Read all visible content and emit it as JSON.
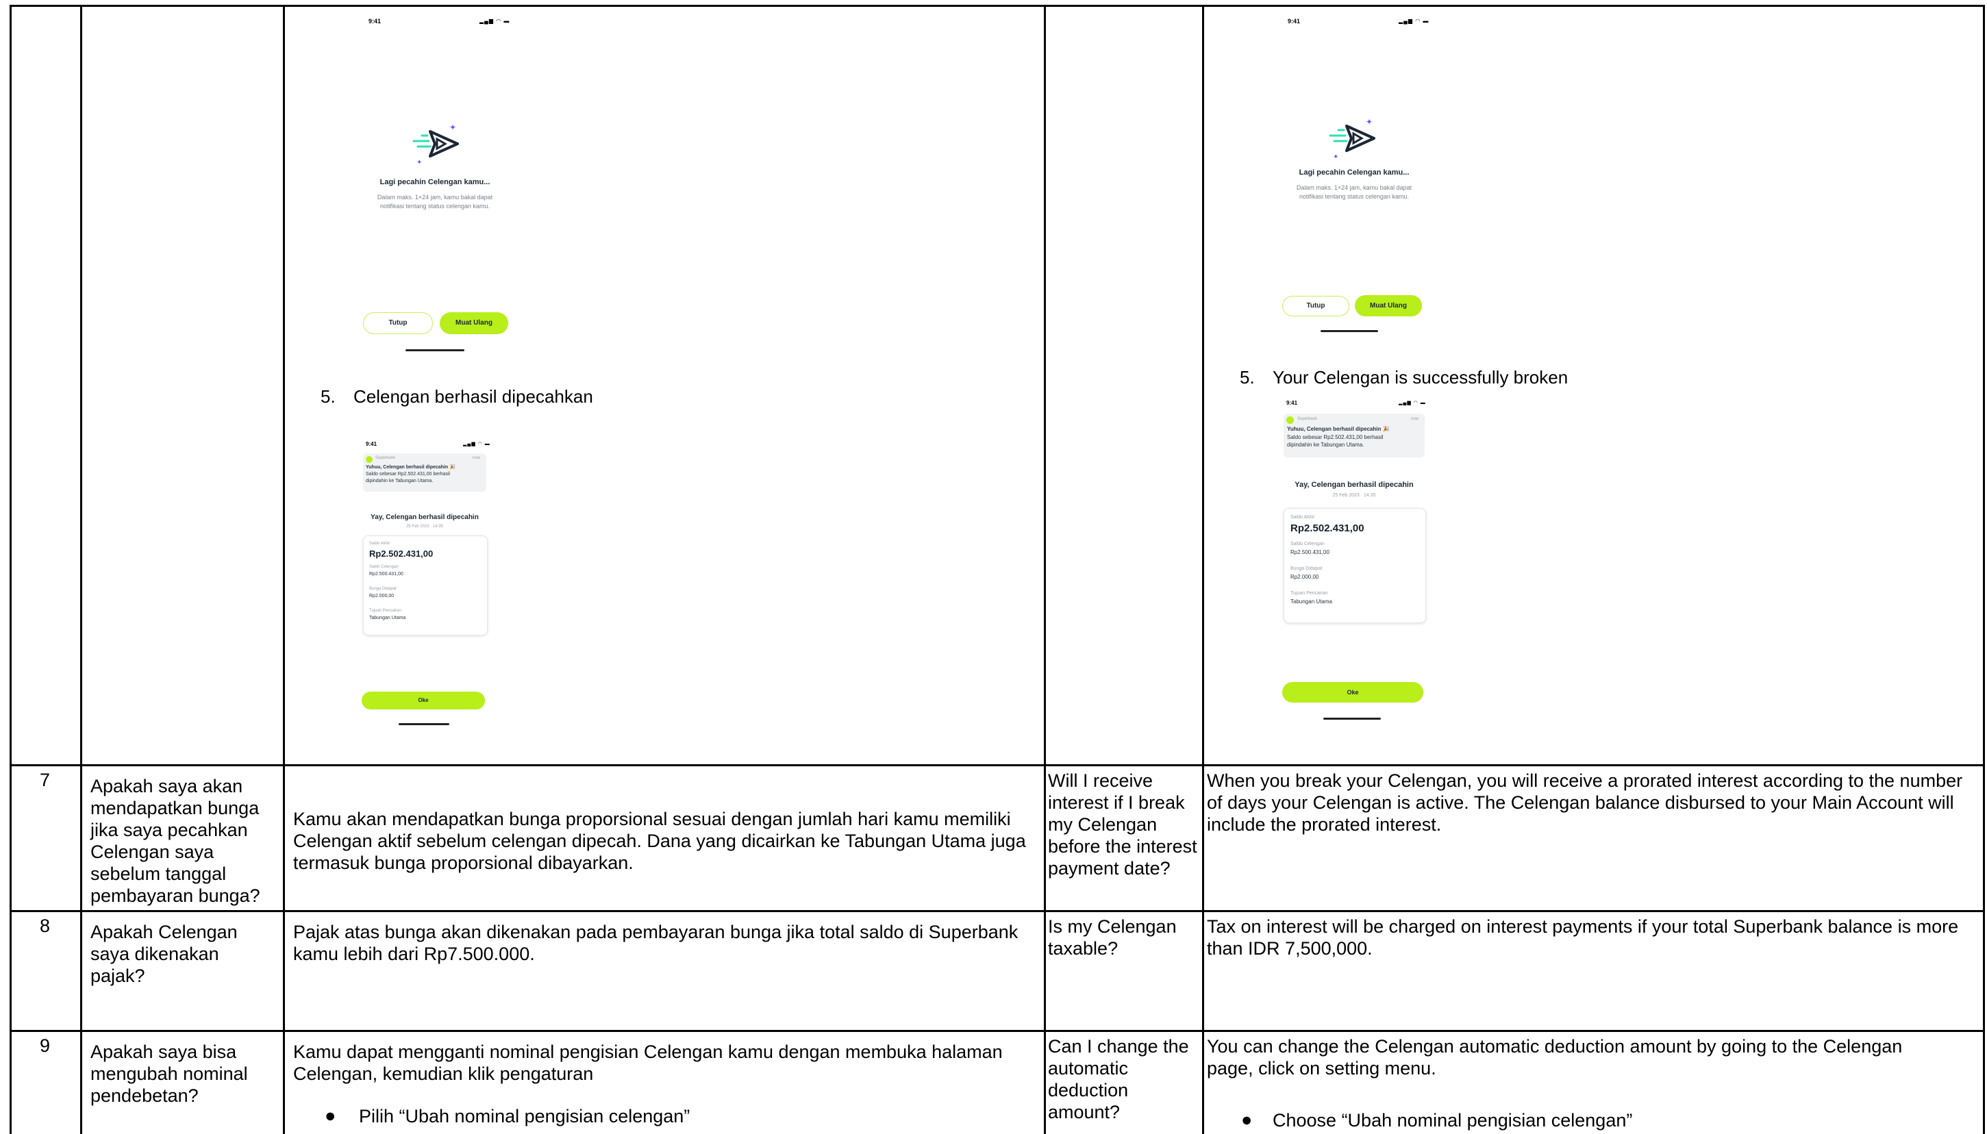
{
  "left_mockup": {
    "status_time": "9:41",
    "status_icons": "▂▄▆ ◠ ▬",
    "title": "Lagi pecahin Celengan kamu...",
    "subtitle_line1": "Dalam maks. 1×24 jam, kamu bakal dapat",
    "subtitle_line2": "notifikasi tentang status celengan kamu.",
    "close_button": "Tutup",
    "reload_button": "Muat Ulang"
  },
  "right_mockup": {
    "status_time": "9:41",
    "status_icons": "▂▄▆ ◠ ▬",
    "title": "Lagi pecahin Celengan kamu...",
    "subtitle_line1": "Dalam maks. 1×24 jam, kamu bakal dapat",
    "subtitle_line2": "notifikasi tentang status celengan kamu.",
    "close_button": "Tutup",
    "reload_button": "Muat Ulang"
  },
  "step5_id": {
    "number": "5.",
    "text": "Celengan berhasil dipecahkan"
  },
  "step5_en": {
    "number": "5.",
    "text": "Your Celengan is successfully broken"
  },
  "success_mockup": {
    "status_time": "9:41",
    "status_icons": "▂▄▆ ◠ ▬",
    "notif_app": "Superbank",
    "notif_time": "now",
    "notif_title": "Yuhuu, Celengan berhasil dipecahin 🎉",
    "notif_body1": "Saldo sebesar Rp2.502.431,00 berhasil",
    "notif_body2": "dipindahin ke Tabungan Utama.",
    "heading": "Yay, Celengan berhasil dipecahin",
    "date": "25 Feb 2023 · 14:35",
    "final_balance_label": "Saldo Akhir",
    "final_balance": "Rp2.502.431,00",
    "celengan_balance_label": "Saldo Celengan",
    "celengan_balance": "Rp2.500.431,00",
    "interest_label": "Bunga Didapat",
    "interest": "Rp2.000,00",
    "destination_label": "Tujuan Pencairan",
    "destination": "Tabungan Utama",
    "ok_button": "Oke"
  },
  "rows": [
    {
      "no": "7",
      "q_id": "Apakah saya akan mendapatkan bunga jika saya pecahkan Celengan saya sebelum tanggal pembayaran bunga?",
      "a_id": "Kamu akan mendapatkan bunga proporsional  sesuai dengan jumlah hari kamu memiliki Celengan aktif sebelum celengan dipecah. Dana yang dicairkan ke Tabungan Utama juga termasuk bunga proporsional dibayarkan.",
      "q_en": "Will I receive interest if I break my Celengan before the interest payment date?",
      "a_en": "When you break your Celengan, you will receive a prorated interest according to the number of days your Celengan is active. The Celengan balance disbursed to your Main Account will include the prorated interest."
    },
    {
      "no": "8",
      "q_id": "Apakah Celengan saya dikenakan pajak?",
      "a_id": "Pajak atas bunga akan dikenakan pada pembayaran bunga jika total saldo di Superbank kamu lebih dari Rp7.500.000.",
      "q_en": "Is my Celengan taxable?",
      "a_en": "Tax on interest will be charged on interest payments if your total Superbank balance is more than IDR 7,500,000."
    },
    {
      "no": "9",
      "q_id": "Apakah saya bisa mengubah nominal pendebetan?",
      "a_id": "Kamu dapat mengganti nominal pengisian Celengan kamu dengan membuka halaman Celengan, kemudian klik pengaturan",
      "a_id_bullet": "Pilih “Ubah nominal pengisian celengan”",
      "q_en": "Can I change the automatic deduction amount?",
      "a_en": "You can change the Celengan automatic deduction amount by going to the Celengan page, click on setting menu.",
      "a_en_bullet": "Choose “Ubah nominal pengisian celengan”"
    }
  ],
  "colors": {
    "accent": "#b8ee1a",
    "teal": "#2ee0b0",
    "navy": "#1b2733",
    "purple": "#7b4dff"
  }
}
